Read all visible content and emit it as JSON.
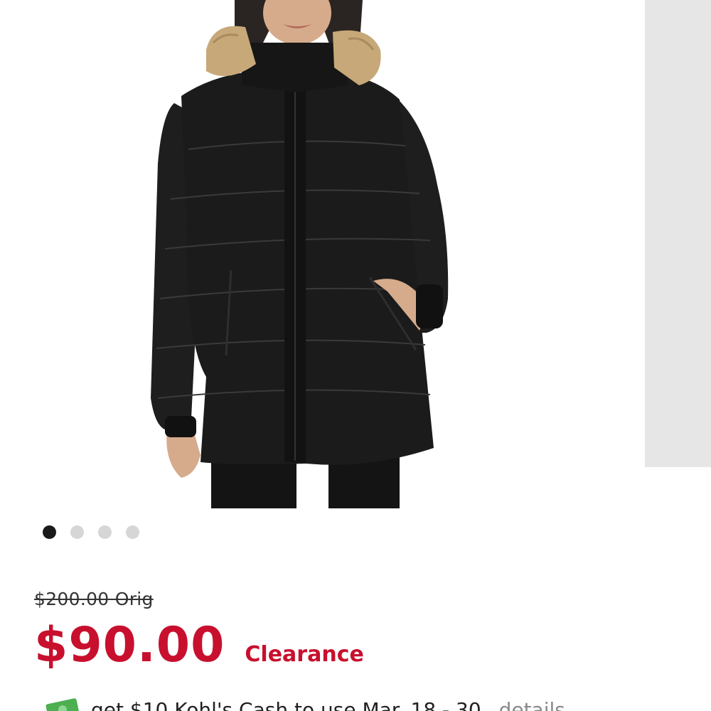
{
  "product": {
    "image_alt": "Women's hooded puffer jacket with faux-fur trim",
    "image_count": 4,
    "active_image": 1
  },
  "pricing": {
    "original": "$200.00 Orig",
    "sale": "$90.00",
    "sale_tag": "Clearance"
  },
  "promo": {
    "text": "get $10 Kohl's Cash to use Mar. 18 - 30.",
    "link": "details",
    "icon": "kohls-cash-icon"
  },
  "colors": {
    "sale_red": "#c8102e",
    "jacket": "#1b1b1b",
    "fur": "#c7a878"
  }
}
